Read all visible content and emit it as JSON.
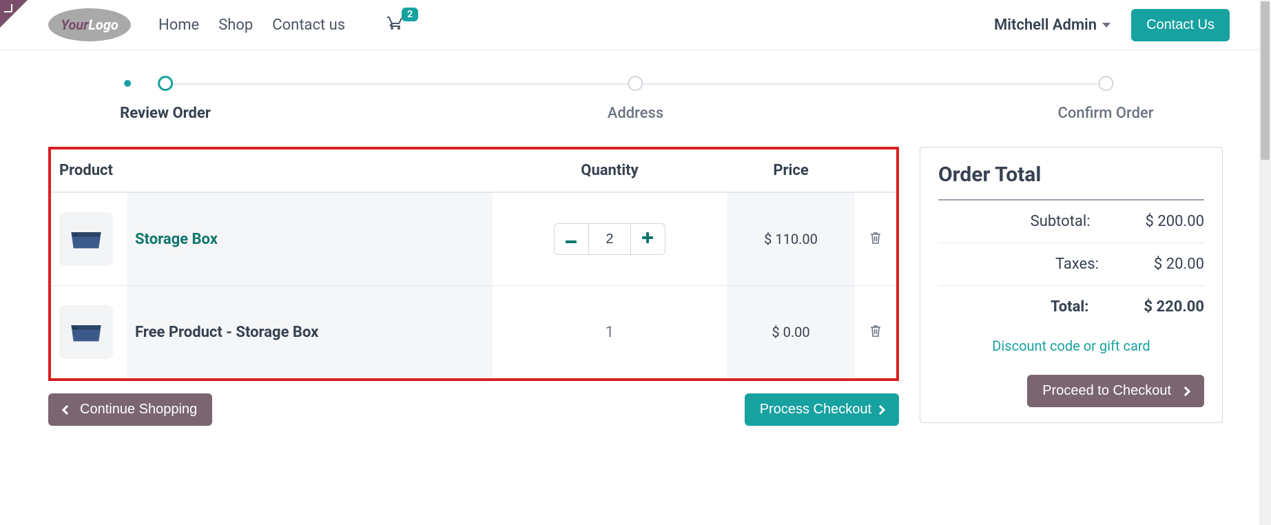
{
  "header": {
    "nav": {
      "home": "Home",
      "shop": "Shop",
      "contact_us": "Contact us"
    },
    "cart_count": "2",
    "user_name": "Mitchell Admin",
    "contact_button": "Contact Us"
  },
  "progress": {
    "steps": [
      "Review Order",
      "Address",
      "Confirm Order"
    ],
    "active_index": 0
  },
  "cart": {
    "columns": {
      "product": "Product",
      "quantity": "Quantity",
      "price": "Price"
    },
    "rows": [
      {
        "name": "Storage Box",
        "is_link": true,
        "quantity": "2",
        "editable_qty": true,
        "price": "$ 110.00"
      },
      {
        "name": "Free Product - Storage Box",
        "is_link": false,
        "quantity": "1",
        "editable_qty": false,
        "price": "$ 0.00"
      }
    ],
    "continue_shopping": "Continue Shopping",
    "process_checkout": "Process Checkout"
  },
  "totals": {
    "heading": "Order Total",
    "subtotal_label": "Subtotal:",
    "subtotal_value": "$ 200.00",
    "taxes_label": "Taxes:",
    "taxes_value": "$ 20.00",
    "total_label": "Total:",
    "total_value": "$ 220.00",
    "discount_link": "Discount code or gift card",
    "proceed": "Proceed to Checkout"
  }
}
